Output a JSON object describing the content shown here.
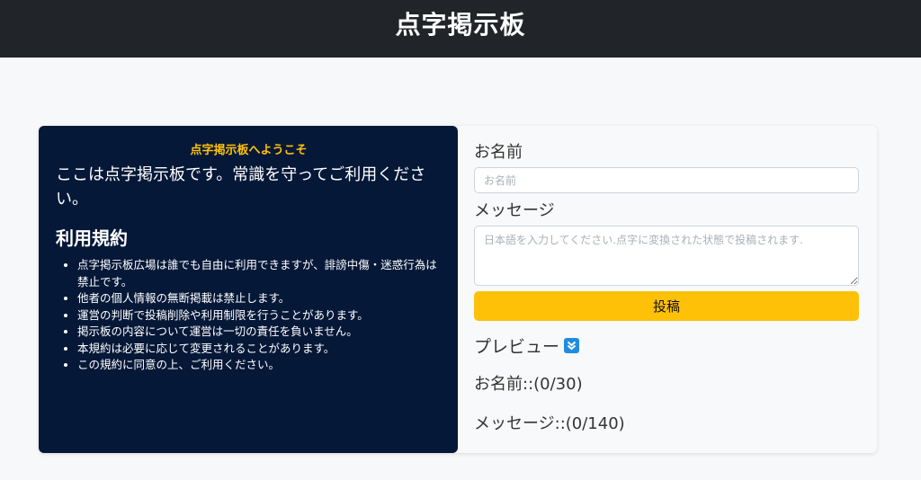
{
  "header": {
    "title": "点字掲示板"
  },
  "info": {
    "welcome": "点字掲示板へようこそ",
    "intro": "ここは点字掲示板です。常識を守ってご利用ください。",
    "terms_title": "利用規約",
    "rules": [
      "点字掲示板広場は誰でも自由に利用できますが、誹謗中傷・迷惑行為は禁止です。",
      "他者の個人情報の無断掲載は禁止します。",
      "運営の判断で投稿削除や利用制限を行うことがあります。",
      "掲示板の内容について運営は一切の責任を負いません。",
      "本規約は必要に応じて変更されることがあります。",
      "この規約に同意の上、ご利用ください。"
    ]
  },
  "form": {
    "name_label": "お名前",
    "name_placeholder": "お名前",
    "name_value": "",
    "message_label": "メッセージ",
    "message_placeholder": "日本語を入力してください.点字に変換された状態で投稿されます.",
    "message_value": "",
    "submit_label": "投稿"
  },
  "preview": {
    "label": "プレビュー",
    "toggle_icon": "chevron-double-down-icon",
    "name_counter": "お名前::(0/30)",
    "message_counter": "メッセージ::(0/140)"
  },
  "colors": {
    "header_bg": "#212529",
    "info_bg": "#061838",
    "accent": "#ffc107",
    "icon_bg": "#1f8ce0"
  }
}
